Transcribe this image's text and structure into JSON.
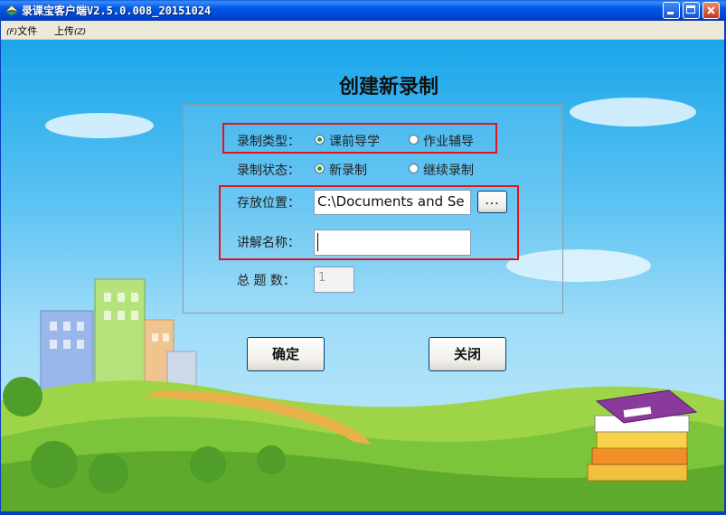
{
  "window": {
    "title": "录课宝客户端V2.5.0.008_20151024"
  },
  "menu": {
    "items": [
      {
        "accel": "(F)",
        "label": "文件"
      },
      {
        "accel": "(Z)",
        "label": "上传"
      }
    ]
  },
  "dialog": {
    "heading": "创建新录制",
    "record_type": {
      "label": "录制类型：",
      "options": [
        {
          "label": "课前导学",
          "selected": true
        },
        {
          "label": "作业辅导",
          "selected": false
        }
      ]
    },
    "record_status": {
      "label": "录制状态：",
      "options": [
        {
          "label": "新录制",
          "selected": true
        },
        {
          "label": "继续录制",
          "selected": false
        }
      ]
    },
    "storage_location": {
      "label": "存放位置：",
      "value": "C:\\Documents and Se",
      "browse_label": "..."
    },
    "lecture_name": {
      "label": "讲解名称：",
      "value": ""
    },
    "total_questions": {
      "label": "总 题 数：",
      "value": "1"
    },
    "buttons": {
      "ok": "确定",
      "close": "关闭"
    }
  },
  "colors": {
    "title_bar": "#0058e6",
    "highlight_box": "#e0141e",
    "radio_selected": "#2a9a3a",
    "sky": "#5cc3f2",
    "grass": "#6fc23a"
  }
}
